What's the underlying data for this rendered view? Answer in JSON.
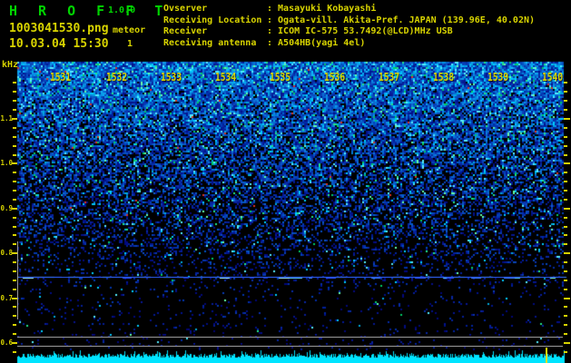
{
  "header": {
    "app_title": "H R O F F T",
    "version": "1.0.0",
    "filename": "1003041530.png",
    "mode": "meteor",
    "datetime": "10.03.04 15:30",
    "count": "1",
    "info": [
      {
        "label": "Ovserver",
        "value": "Masayuki Kobayashi"
      },
      {
        "label": "Receiving Location",
        "value": "Ogata-vill. Akita-Pref. JAPAN (139.96E, 40.02N)"
      },
      {
        "label": "Receiver",
        "value": "ICOM IC-575 53.7492(@LCD)MHz USB"
      },
      {
        "label": "Receiving antenna",
        "value": "A504HB(yagi 4el)"
      }
    ]
  },
  "chart_data": {
    "type": "heatmap",
    "description": "Radio meteor observation FFT spectrogram (waterfall over 10 minutes); dense blue noise fading toward lower frequencies, no large meteor echo columns visible",
    "x": {
      "tick_labels": [
        "1531",
        "1532",
        "1533",
        "1534",
        "1535",
        "1536",
        "1537",
        "1538",
        "1539",
        "1540"
      ],
      "start_label": "1531",
      "end_label": "1540"
    },
    "y": {
      "unit": "kHz",
      "tick_labels": [
        "1.1",
        "1.0",
        "0.9",
        "0.8",
        "0.7",
        "0.6"
      ],
      "tick_values": [
        1.1,
        1.0,
        0.9,
        0.8,
        0.7,
        0.6
      ],
      "minor_step_khz": 0.02,
      "top_khz": 1.18,
      "bottom_khz": 0.58
    },
    "features": {
      "carrier_line_khz": 0.75,
      "reference_lines_khz": [
        0.615,
        0.595
      ],
      "amplitude_strip": "cyan jagged signal-level band along bottom edge",
      "event_marker_time_approx": "15:39:41"
    },
    "legend": "none",
    "grid": "off"
  },
  "colors": {
    "background": "#000000",
    "title_green": "#00d400",
    "text_yellow": "#d8d400",
    "tick_yellow": "#d8d400",
    "gray_line": "#9a9a9a",
    "carrier_base": "#2a55dd",
    "carrier_bright": [
      "#9ae8ff",
      "#55c8ff",
      "#3a7dff",
      "#79f2d2",
      "#2a50ff",
      "#1a35cc"
    ],
    "band_cyan": "#00e4ff",
    "marker_yellow": "#e8e000",
    "noise_greens": [
      "#00cc66",
      "#22e688",
      "#66ffaa"
    ],
    "noise_cyans": [
      "#00aadd",
      "#00ccff",
      "#55eeff"
    ],
    "noise_red": "#dd3322"
  }
}
